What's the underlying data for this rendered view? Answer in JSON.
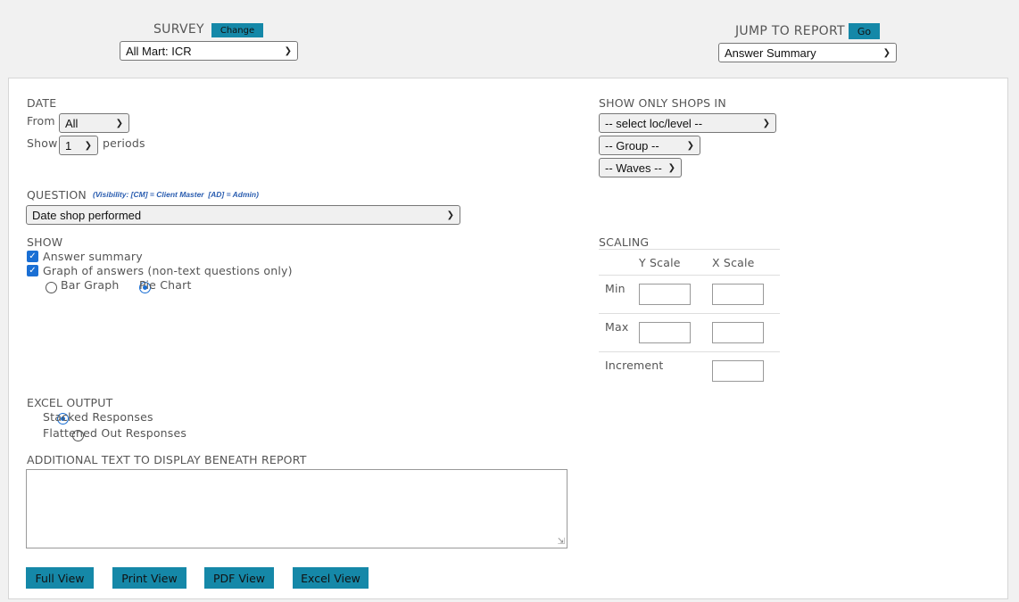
{
  "survey": {
    "label": "SURVEY",
    "change_button": "Change",
    "selected": "All Mart: ICR"
  },
  "jump": {
    "label": "JUMP TO REPORT",
    "go_button": "Go",
    "selected": "Answer Summary"
  },
  "date": {
    "heading": "DATE",
    "from_label": "From",
    "from_value": "All",
    "show_label": "Show",
    "show_value": "1",
    "periods_label": "periods"
  },
  "shops": {
    "heading": "SHOW ONLY SHOPS IN",
    "loc_select": "-- select loc/level --",
    "group_select": "-- Group --",
    "waves_select": "-- Waves --"
  },
  "question": {
    "heading": "QUESTION",
    "visibility_note": "(Visibility: [CM] = Client Master  [AD] = Admin)",
    "selected": "Date shop performed"
  },
  "show": {
    "heading": "SHOW",
    "answer_summary": "Answer summary",
    "answer_summary_checked": true,
    "graph_answers": "Graph of answers (non-text questions only)",
    "graph_answers_checked": true,
    "bar_graph": "Bar Graph",
    "pie_chart": "Pie Chart",
    "graph_type": "Pie Chart"
  },
  "scaling": {
    "heading": "SCALING",
    "y_scale": "Y Scale",
    "x_scale": "X Scale",
    "min": "Min",
    "max": "Max",
    "increment": "Increment"
  },
  "excel": {
    "heading": "EXCEL OUTPUT",
    "stacked": "Stacked Responses",
    "flattened": "Flattened Out Responses",
    "selected": "Stacked Responses"
  },
  "additional_text": {
    "heading": "ADDITIONAL TEXT TO DISPLAY BENEATH REPORT",
    "value": ""
  },
  "buttons": {
    "full_view": "Full View",
    "print_view": "Print View",
    "pdf_view": "PDF View",
    "excel_view": "Excel View"
  },
  "colors": {
    "accent_button": "#1588a8",
    "checkbox": "#1a6fd4",
    "note_text": "#2a5db0"
  }
}
